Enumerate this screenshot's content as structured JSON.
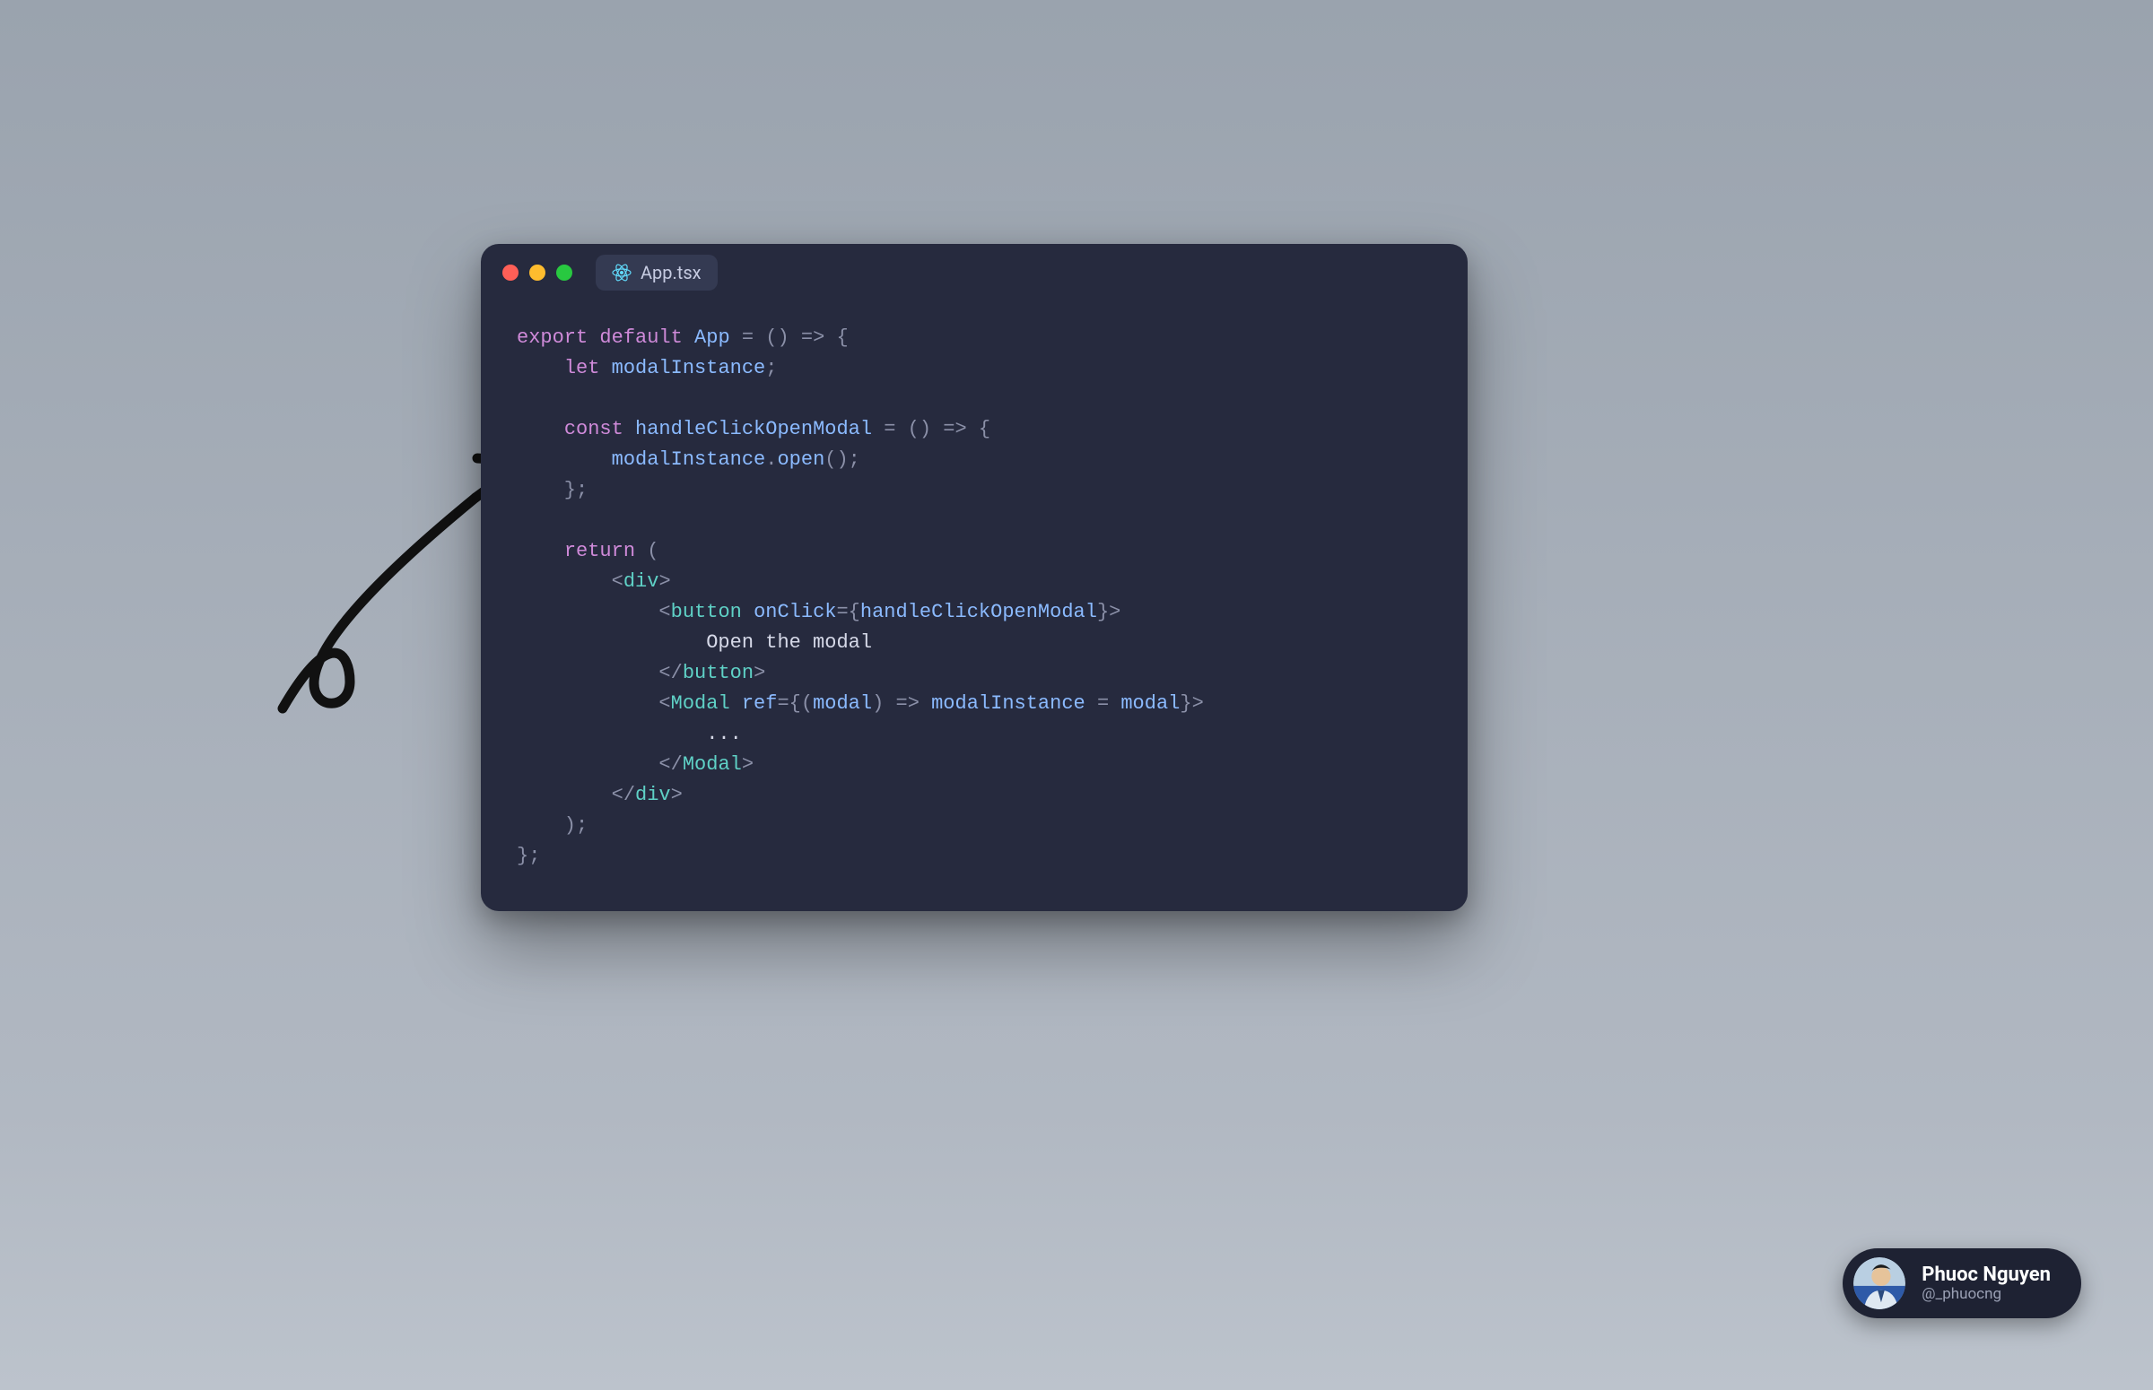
{
  "colors": {
    "window_bg": "#262a3e",
    "tab_bg": "#343a52",
    "traffic_red": "#ff5f57",
    "traffic_yellow": "#febc2e",
    "traffic_green": "#28c840",
    "token_keyword": "#cf8ad9",
    "token_ident": "#8bbaff",
    "token_tag": "#5fd1c6",
    "token_punc": "#8b90a8",
    "react_icon": "#61dafb"
  },
  "window": {
    "tab_filename": "App.tsx",
    "tab_icon": "react-icon",
    "traffic_lights": [
      "red",
      "yellow",
      "green"
    ]
  },
  "code_lines": [
    [
      {
        "t": "key",
        "v": "export "
      },
      {
        "t": "key",
        "v": "default "
      },
      {
        "t": "fn",
        "v": "App "
      },
      {
        "t": "punc",
        "v": "= () => {"
      }
    ],
    [
      {
        "t": "punc",
        "v": "    "
      },
      {
        "t": "key",
        "v": "let "
      },
      {
        "t": "fn",
        "v": "modalInstance"
      },
      {
        "t": "punc",
        "v": ";"
      }
    ],
    [],
    [
      {
        "t": "punc",
        "v": "    "
      },
      {
        "t": "key",
        "v": "const "
      },
      {
        "t": "fn",
        "v": "handleClickOpenModal "
      },
      {
        "t": "punc",
        "v": "= () => {"
      }
    ],
    [
      {
        "t": "punc",
        "v": "        "
      },
      {
        "t": "fn",
        "v": "modalInstance"
      },
      {
        "t": "punc",
        "v": "."
      },
      {
        "t": "fn",
        "v": "open"
      },
      {
        "t": "punc",
        "v": "();"
      }
    ],
    [
      {
        "t": "punc",
        "v": "    };"
      }
    ],
    [],
    [
      {
        "t": "punc",
        "v": "    "
      },
      {
        "t": "key",
        "v": "return "
      },
      {
        "t": "punc",
        "v": "("
      }
    ],
    [
      {
        "t": "punc",
        "v": "        <"
      },
      {
        "t": "tag",
        "v": "div"
      },
      {
        "t": "punc",
        "v": ">"
      }
    ],
    [
      {
        "t": "punc",
        "v": "            <"
      },
      {
        "t": "tag",
        "v": "button "
      },
      {
        "t": "fn",
        "v": "onClick"
      },
      {
        "t": "punc",
        "v": "={"
      },
      {
        "t": "fn",
        "v": "handleClickOpenModal"
      },
      {
        "t": "punc",
        "v": "}>"
      }
    ],
    [
      {
        "t": "text",
        "v": "                Open the modal"
      }
    ],
    [
      {
        "t": "punc",
        "v": "            </"
      },
      {
        "t": "tag",
        "v": "button"
      },
      {
        "t": "punc",
        "v": ">"
      }
    ],
    [
      {
        "t": "punc",
        "v": "            <"
      },
      {
        "t": "tag",
        "v": "Modal "
      },
      {
        "t": "fn",
        "v": "ref"
      },
      {
        "t": "punc",
        "v": "={("
      },
      {
        "t": "fn",
        "v": "modal"
      },
      {
        "t": "punc",
        "v": ") => "
      },
      {
        "t": "fn",
        "v": "modalInstance "
      },
      {
        "t": "punc",
        "v": "= "
      },
      {
        "t": "fn",
        "v": "modal"
      },
      {
        "t": "punc",
        "v": "}>"
      }
    ],
    [
      {
        "t": "text",
        "v": "                ..."
      }
    ],
    [
      {
        "t": "punc",
        "v": "            </"
      },
      {
        "t": "tag",
        "v": "Modal"
      },
      {
        "t": "punc",
        "v": ">"
      }
    ],
    [
      {
        "t": "punc",
        "v": "        </"
      },
      {
        "t": "tag",
        "v": "div"
      },
      {
        "t": "punc",
        "v": ">"
      }
    ],
    [
      {
        "t": "punc",
        "v": "    );"
      }
    ],
    [
      {
        "t": "punc",
        "v": "};"
      }
    ]
  ],
  "author": {
    "name": "Phuoc Nguyen",
    "handle": "@_phuocng"
  },
  "arrow_icon": "hand-drawn-arrow"
}
